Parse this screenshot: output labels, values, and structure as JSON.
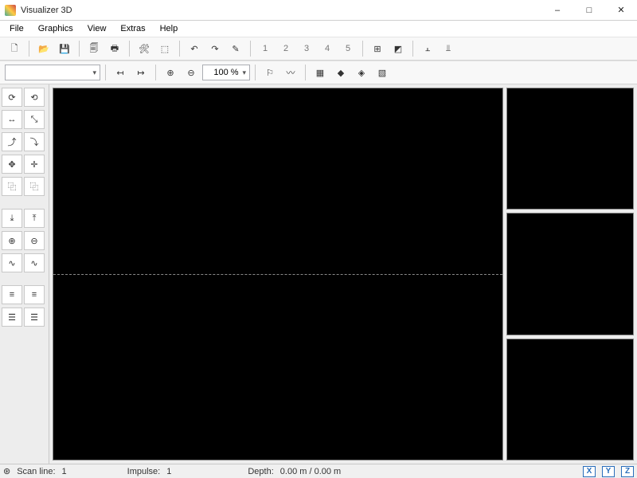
{
  "window": {
    "title": "Visualizer 3D",
    "minimize": "–",
    "maximize": "□",
    "close": "✕"
  },
  "menu": {
    "file": "File",
    "graphics": "Graphics",
    "view": "View",
    "extras": "Extras",
    "help": "Help"
  },
  "toolbar1": {
    "new": "🗋",
    "open": "📂",
    "save": "💾",
    "page": "🗐",
    "print": "🖶",
    "tools": "🛠",
    "mode": "⬚",
    "undo": "↶",
    "redo": "↷",
    "curve": "✎",
    "n1": "1",
    "n2": "2",
    "n3": "3",
    "n4": "4",
    "n5": "5",
    "grid": "⊞",
    "snap": "◩",
    "chart1": "⫠",
    "chart2": "⫫"
  },
  "toolbar2": {
    "combo_value": "",
    "arrow_l": "↤",
    "arrow_r": "↦",
    "zoom_in": "⊕",
    "zoom_out": "⊖",
    "zoom_value": "100 %",
    "marker": "⚐",
    "wave": "〰",
    "shade1": "▦",
    "shade2": "◆",
    "shade3": "◈",
    "shade4": "▧"
  },
  "ltools": {
    "rot_cw": "⟳",
    "rot_ccw": "⟲",
    "flip_h": "↔",
    "flip_hr": "⤡",
    "rot_up": "⤴",
    "rot_dn": "⤵",
    "move": "✥",
    "move2": "✛",
    "crop": "⿻",
    "crop2": "⿻",
    "line_d": "⤓",
    "line_u": "⤒",
    "zoomin": "⊕",
    "zoomout": "⊖",
    "sig_a": "∿",
    "sig_b": "∿",
    "eq1": "≡",
    "eq2": "≡",
    "eq3": "☰",
    "eq4": "☰"
  },
  "status": {
    "scanline_label": "Scan line:",
    "scanline_value": "1",
    "impulse_label": "Impulse:",
    "impulse_value": "1",
    "depth_label": "Depth:",
    "depth_value": "0.00 m / 0.00 m",
    "axis_x": "X",
    "axis_y": "Y",
    "axis_z": "Z"
  }
}
